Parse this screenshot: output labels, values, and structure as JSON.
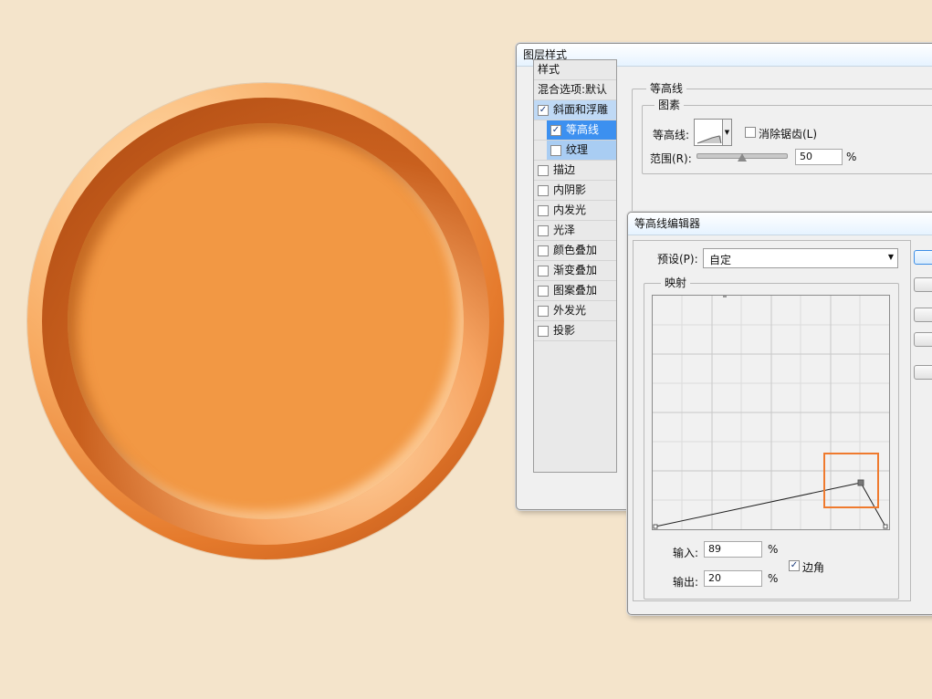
{
  "layer_style": {
    "title": "图层样式",
    "styles_header": "样式",
    "blend_options": "混合选项:默认",
    "items": [
      {
        "label": "斜面和浮雕",
        "checked": true
      },
      {
        "label": "等高线",
        "checked": true
      },
      {
        "label": "纹理",
        "checked": false
      },
      {
        "label": "描边",
        "checked": false
      },
      {
        "label": "内阴影",
        "checked": false
      },
      {
        "label": "内发光",
        "checked": false
      },
      {
        "label": "光泽",
        "checked": false
      },
      {
        "label": "颜色叠加",
        "checked": false
      },
      {
        "label": "渐变叠加",
        "checked": false
      },
      {
        "label": "图案叠加",
        "checked": false
      },
      {
        "label": "外发光",
        "checked": false
      },
      {
        "label": "投影",
        "checked": false
      }
    ],
    "panel_title": "等高线",
    "elements_group": "图素",
    "contour_label": "等高线:",
    "antialias_label": "消除锯齿(L)",
    "range_label": "范围(R):",
    "range_value": "50",
    "percent": "%",
    "range_slider_level": 0.5
  },
  "contour_editor": {
    "title": "等高线编辑器",
    "preset_label": "预设(P):",
    "preset_value": "自定",
    "mapping_group": "映射",
    "input_label": "输入:",
    "input_value": "89",
    "output_label": "输出:",
    "output_value": "20",
    "percent": "%",
    "corner_label": "边角",
    "corner_checked": true
  }
}
